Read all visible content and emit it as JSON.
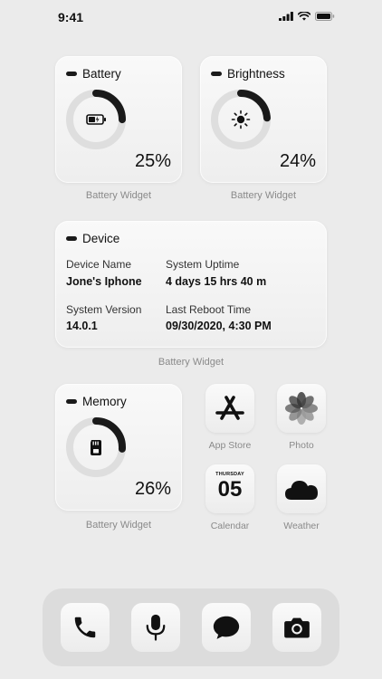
{
  "status_bar": {
    "time": "9:41"
  },
  "battery_widget": {
    "title": "Battery",
    "percent_label": "25%",
    "level": 0.25,
    "caption": "Battery Widget"
  },
  "brightness_widget": {
    "title": "Brightness",
    "percent_label": "24%",
    "level": 0.24,
    "caption": "Battery Widget"
  },
  "device_widget": {
    "title": "Device",
    "device_name_label": "Device Name",
    "device_name": "Jone's Iphone",
    "uptime_label": "System Uptime",
    "uptime": "4 days 15 hrs 40 m",
    "version_label": "System Version",
    "version": "14.0.1",
    "reboot_label": "Last Reboot Time",
    "reboot": "09/30/2020, 4:30 PM",
    "caption": "Battery Widget"
  },
  "memory_widget": {
    "title": "Memory",
    "percent_label": "26%",
    "level": 0.26,
    "caption": "Battery Widget"
  },
  "apps": {
    "app_store": "App Store",
    "photo": "Photo",
    "calendar": "Calendar",
    "calendar_day": "THURSDAY",
    "calendar_date": "05",
    "weather": "Weather"
  },
  "dock": {
    "icons": [
      "phone-icon",
      "microphone-icon",
      "message-icon",
      "camera-icon"
    ]
  },
  "colors": {
    "background": "#ebebeb",
    "gauge_fill": "#1a1a1a",
    "gauge_track": "#dedede",
    "caption": "#8a8a8a"
  }
}
